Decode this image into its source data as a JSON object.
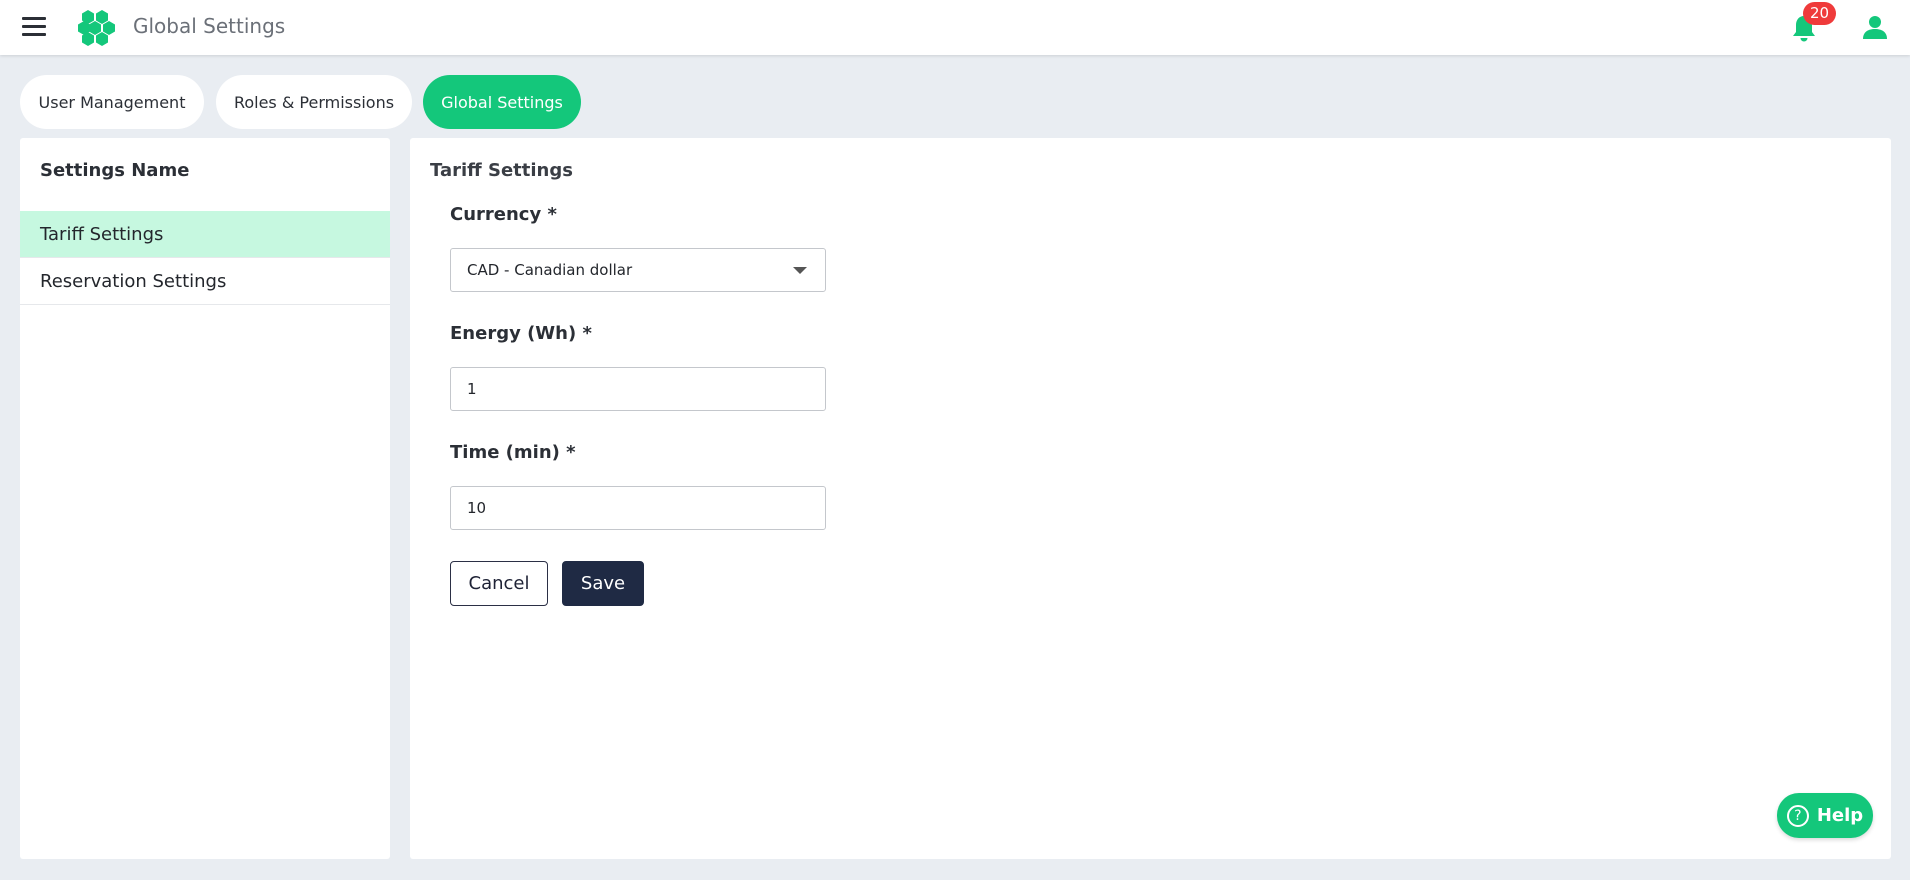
{
  "header": {
    "title": "Global Settings",
    "notification_count": "20",
    "accent_color": "#14c77b"
  },
  "tabs": [
    {
      "label": "User Management"
    },
    {
      "label": "Roles & Permissions"
    },
    {
      "label": "Global Settings",
      "active": true
    }
  ],
  "sidebar": {
    "heading": "Settings Name",
    "items": [
      {
        "label": "Tariff Settings",
        "active": true
      },
      {
        "label": "Reservation Settings"
      }
    ]
  },
  "form": {
    "section_title": "Tariff Settings",
    "currency": {
      "label": "Currency *",
      "value": "CAD - Canadian dollar"
    },
    "energy": {
      "label": "Energy (Wh) *",
      "value": "1"
    },
    "time": {
      "label": "Time (min) *",
      "value": "10"
    },
    "cancel_label": "Cancel",
    "save_label": "Save"
  },
  "help": {
    "label": "Help",
    "icon": "question-circle-icon"
  }
}
